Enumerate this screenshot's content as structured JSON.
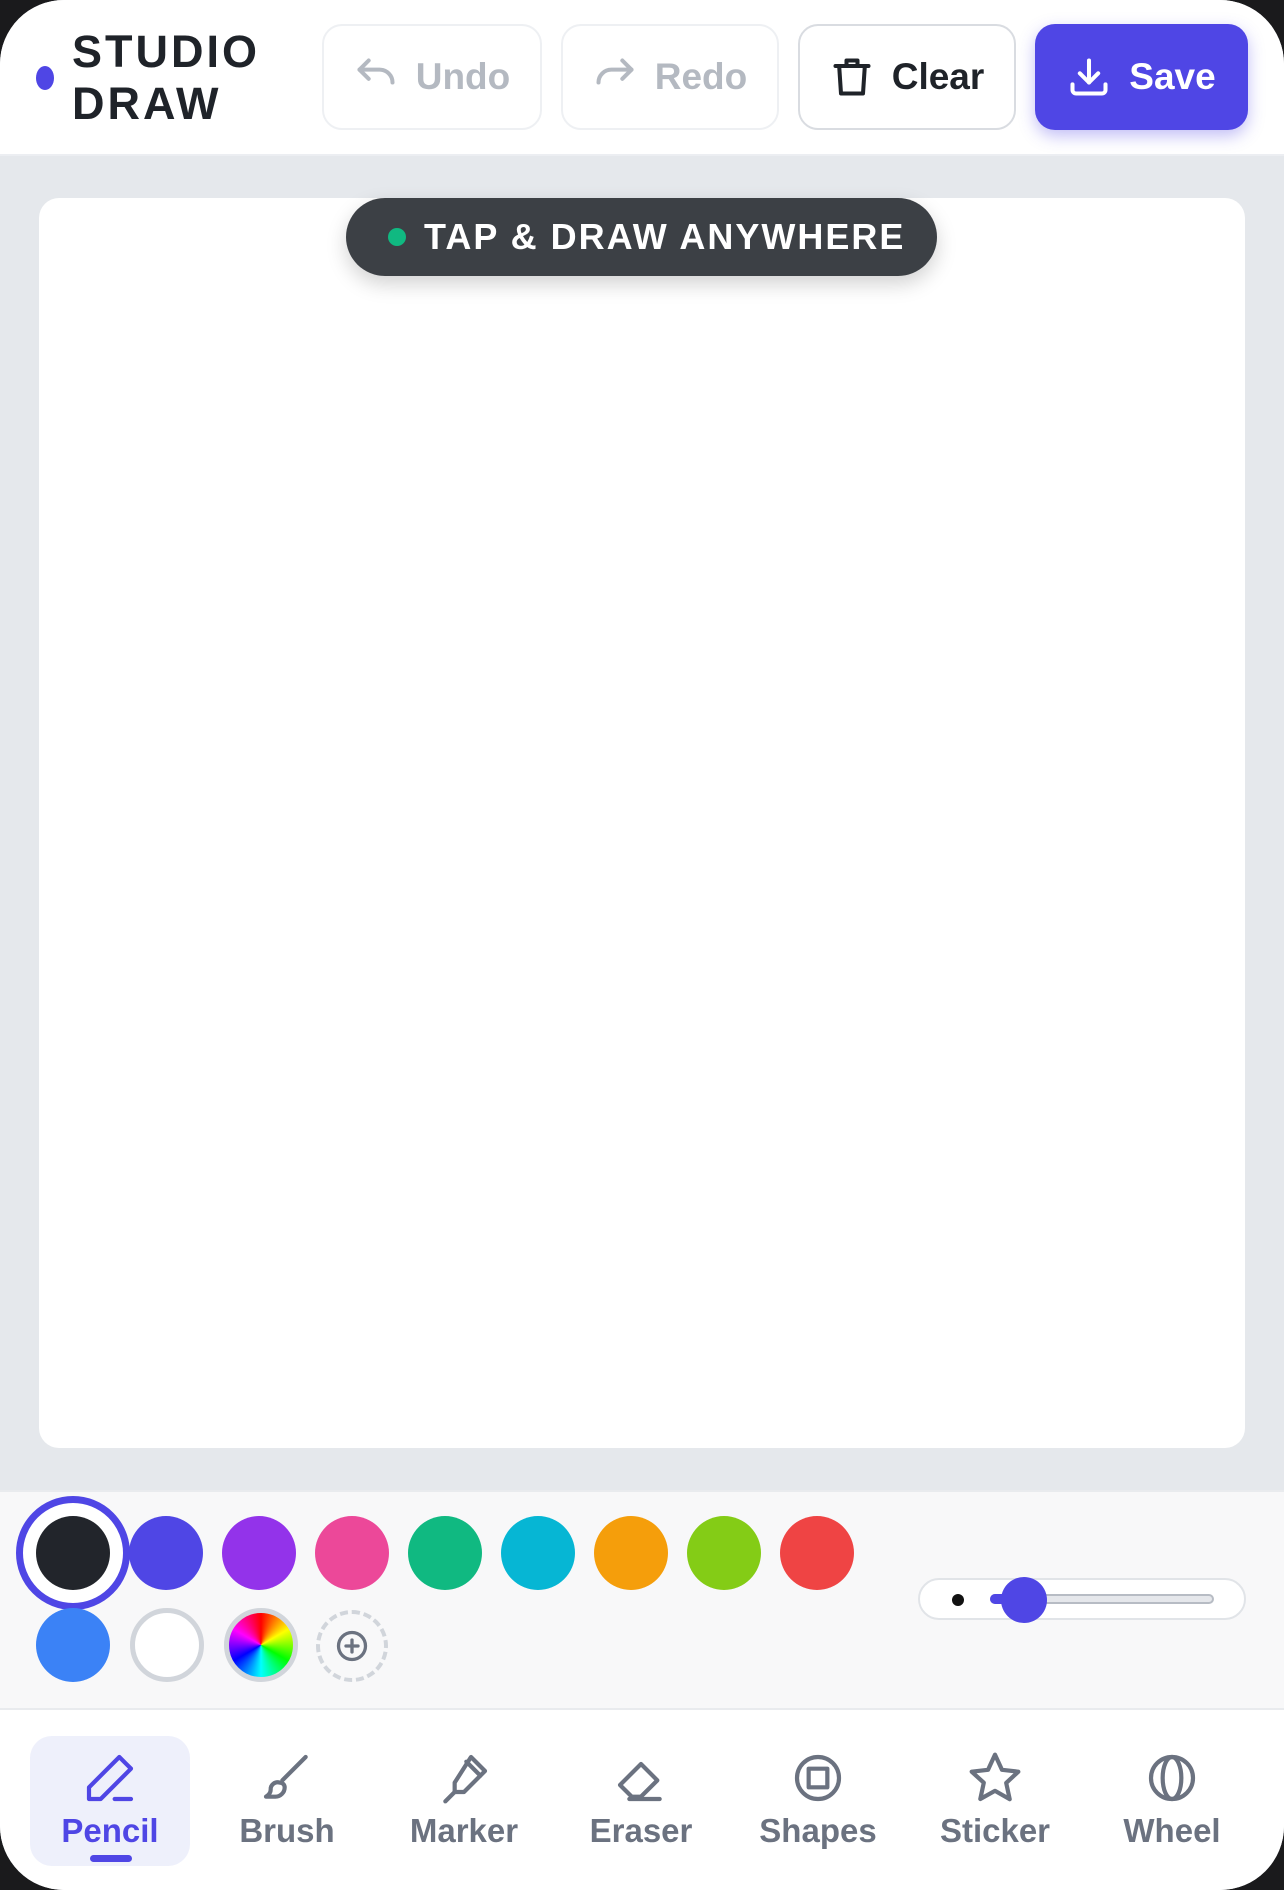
{
  "app": {
    "title_line1": "STUDIO",
    "title_line2": "DRAW",
    "accent_color": "#4f46e5"
  },
  "toolbar": {
    "undo_label": "Undo",
    "redo_label": "Redo",
    "clear_label": "Clear",
    "save_label": "Save"
  },
  "canvas": {
    "hint": "TAP & DRAW ANYWHERE"
  },
  "palette": {
    "colors": [
      "#22252b",
      "#4f46e5",
      "#9333ea",
      "#ec4899",
      "#10b981",
      "#06b6d4",
      "#f59e0b",
      "#84cc16",
      "#ef4444",
      "#3b82f6",
      "#ffffff"
    ],
    "selected_color": "#22252b",
    "brush_size_level": 0.15
  },
  "tools": [
    {
      "label": "Pencil",
      "icon": "pencil-icon",
      "active": true
    },
    {
      "label": "Brush",
      "icon": "brush-icon",
      "active": false
    },
    {
      "label": "Marker",
      "icon": "marker-icon",
      "active": false
    },
    {
      "label": "Eraser",
      "icon": "eraser-icon",
      "active": false
    },
    {
      "label": "Shapes",
      "icon": "shapes-icon",
      "active": false
    },
    {
      "label": "Sticker",
      "icon": "star-icon",
      "active": false
    },
    {
      "label": "Wheel",
      "icon": "wheel-icon",
      "active": false
    }
  ]
}
